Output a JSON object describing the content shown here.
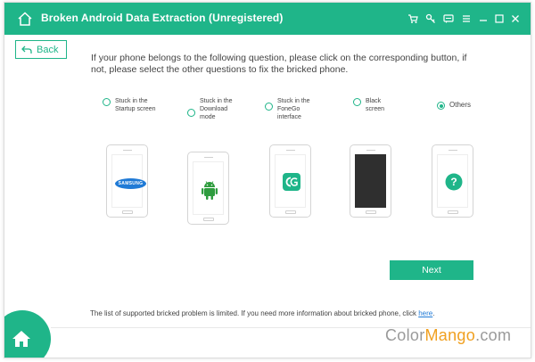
{
  "window": {
    "title": "Broken Android Data Extraction (Unregistered)"
  },
  "toolbar": {
    "icons": [
      "cart-icon",
      "key-icon",
      "feedback-icon",
      "menu-icon",
      "minimize-icon",
      "maximize-icon",
      "close-icon"
    ]
  },
  "back": {
    "label": "Back"
  },
  "instruction": "If your phone belongs to the following question, please click on the corresponding button, if not, please select the other questions to fix the bricked phone.",
  "options": [
    {
      "label": "Stuck in the Startup screen",
      "selected": false
    },
    {
      "label": "Stuck in the Download mode",
      "selected": false
    },
    {
      "label": "Stuck in the FoneGo interface",
      "selected": false
    },
    {
      "label": "Black screen",
      "selected": false
    },
    {
      "label": "Others",
      "selected": true
    }
  ],
  "phones": {
    "samsung_text": "SAMSUNG"
  },
  "next": {
    "label": "Next"
  },
  "footer": {
    "note": "The list of supported bricked problem is limited. If you need more information about bricked phone, click",
    "link": "here",
    "period": "."
  },
  "watermark": {
    "part1": "Color",
    "part2": "Mango",
    "part3": ".com"
  },
  "colors": {
    "accent": "#1fb589",
    "link": "#1f7ad6"
  }
}
